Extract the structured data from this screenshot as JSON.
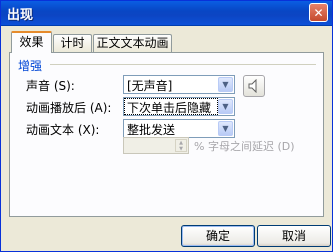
{
  "window": {
    "title": "出现",
    "close_glyph": "✕"
  },
  "tabs": [
    {
      "label": "效果",
      "active": true
    },
    {
      "label": "计时",
      "active": false
    },
    {
      "label": "正文文本动画",
      "active": false
    }
  ],
  "enhance": {
    "group_label": "增强",
    "sound": {
      "label": "声音 (S):",
      "value": "[无声音]"
    },
    "after_animation": {
      "label": "动画播放后 (A):",
      "value": "下次单击后隐藏"
    },
    "animate_text": {
      "label": "动画文本 (X):",
      "value": "整批发送"
    },
    "delay": {
      "value": "",
      "suffix": "% 字母之间延迟 (D)"
    }
  },
  "icons": {
    "speaker": "speaker-icon",
    "dropdown": "chevron-down-icon"
  },
  "buttons": {
    "ok": "确定",
    "cancel": "取消"
  },
  "colors": {
    "title_bar": "#0a5ee3",
    "group_label": "#0046d5",
    "selection": "#316ac5",
    "active_tab_accent": "#e68b2c"
  }
}
